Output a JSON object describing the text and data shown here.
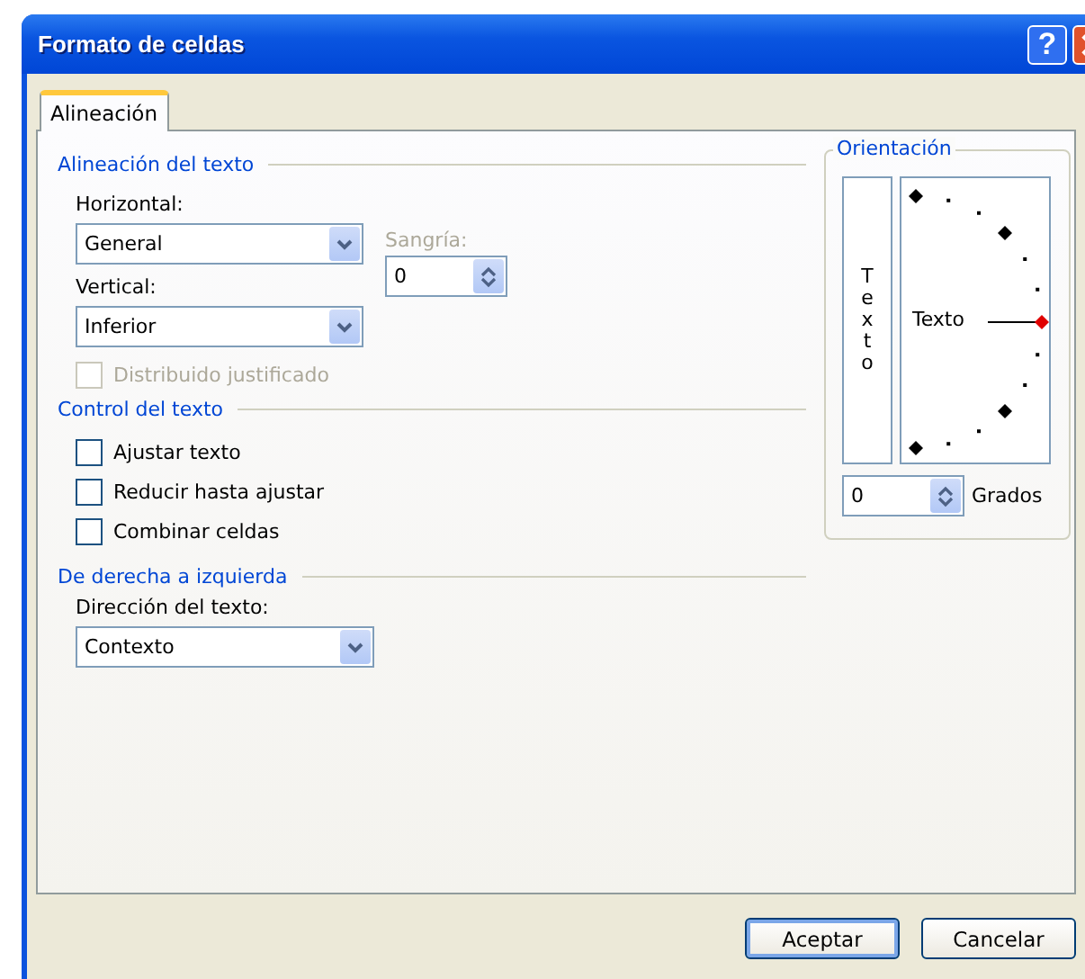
{
  "window": {
    "title": "Formato de celdas",
    "help": "?"
  },
  "tabs": [
    {
      "label": "Alineación",
      "selected": true
    }
  ],
  "text_alignment": {
    "heading": "Alineación del texto",
    "horizontal": {
      "label": "Horizontal:",
      "value": "General"
    },
    "vertical": {
      "label": "Vertical:",
      "value": "Inferior"
    },
    "indent": {
      "label": "Sangría:",
      "value": "0",
      "disabled": true
    },
    "distributed": {
      "label": "Distribuido justificado",
      "checked": false,
      "disabled": true
    }
  },
  "text_control": {
    "heading": "Control del texto",
    "options": [
      {
        "label": "Ajustar texto",
        "checked": false
      },
      {
        "label": "Reducir hasta ajustar",
        "checked": false
      },
      {
        "label": "Combinar celdas",
        "checked": false
      }
    ]
  },
  "right_to_left": {
    "heading": "De derecha a izquierda",
    "direction": {
      "label": "Dirección del texto:",
      "value": "Contexto"
    }
  },
  "orientation": {
    "heading": "Orientación",
    "vertical_text": "Texto",
    "dial_text": "Texto",
    "degrees": {
      "value": "0",
      "label": "Grados"
    }
  },
  "buttons": [
    {
      "label": "Aceptar",
      "default": true
    },
    {
      "label": "Cancelar",
      "default": false
    }
  ]
}
